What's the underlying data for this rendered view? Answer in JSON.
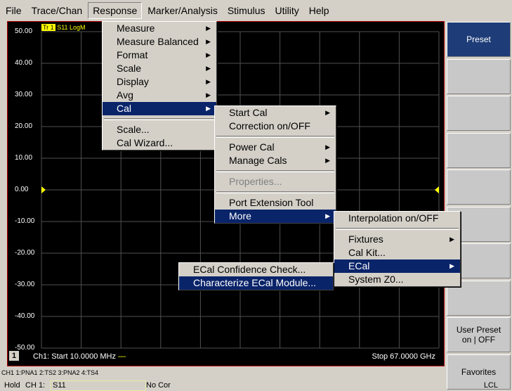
{
  "menubar": [
    "File",
    "Trace/Chan",
    "Response",
    "Marker/Analysis",
    "Stimulus",
    "Utility",
    "Help"
  ],
  "plot": {
    "trace_tag": "Tr 1",
    "trace_info": "S11 LogM",
    "y_ticks": [
      "50.00",
      "40.00",
      "30.00",
      "20.00",
      "10.00",
      "0.00",
      "-10.00",
      "-20.00",
      "-30.00",
      "-40.00",
      "-50.00"
    ],
    "channel": "1",
    "start_label": "Ch1: Start  10.0000 MHz",
    "stop_label": "Stop  67.0000 GHz"
  },
  "softkeys": [
    "Preset",
    "",
    "",
    "",
    "",
    "",
    "",
    "",
    "User Preset on | OFF",
    "Favorites"
  ],
  "response_menu": [
    {
      "label": "Measure",
      "submenu": true
    },
    {
      "label": "Measure Balanced",
      "submenu": true
    },
    {
      "label": "Format",
      "submenu": true
    },
    {
      "label": "Scale",
      "submenu": true
    },
    {
      "label": "Display",
      "submenu": true
    },
    {
      "label": "Avg",
      "submenu": true
    },
    {
      "label": "Cal",
      "submenu": true,
      "highlighted": true
    },
    {
      "label": "Scale...",
      "separator_before": true
    },
    {
      "label": "Cal Wizard..."
    }
  ],
  "cal_menu": [
    {
      "label": "Start Cal",
      "submenu": true
    },
    {
      "label": "Correction on/OFF"
    },
    {
      "label": "Power Cal",
      "submenu": true,
      "separator_before": true
    },
    {
      "label": "Manage Cals",
      "submenu": true
    },
    {
      "label": "Properties...",
      "separator_before": true,
      "disabled": true
    },
    {
      "label": "Port Extension Tool",
      "separator_before": true
    },
    {
      "label": "More",
      "submenu": true,
      "highlighted": true
    }
  ],
  "more_menu": [
    {
      "label": "Interpolation on/OFF"
    },
    {
      "label": "Fixtures",
      "submenu": true,
      "separator_before": true
    },
    {
      "label": "Cal Kit..."
    },
    {
      "label": "ECal",
      "submenu": true,
      "highlighted": true
    },
    {
      "label": "System Z0..."
    }
  ],
  "ecal_menu": [
    {
      "label": "ECal Confidence Check..."
    },
    {
      "label": "Characterize ECal Module...",
      "highlighted": true
    }
  ],
  "status": {
    "channels": "CH1 1:PNA1  2:TS2  3:PNA2  4:TS4",
    "hold": "Hold",
    "ch_label": "CH 1:",
    "measurement": "S11",
    "correction": "No Cor",
    "lcl": "LCL"
  },
  "colors": {
    "trace": "#ffff00",
    "menu_highlight": "#0a246a",
    "preset_key": "#1e3c78",
    "frame": "#b00000"
  }
}
